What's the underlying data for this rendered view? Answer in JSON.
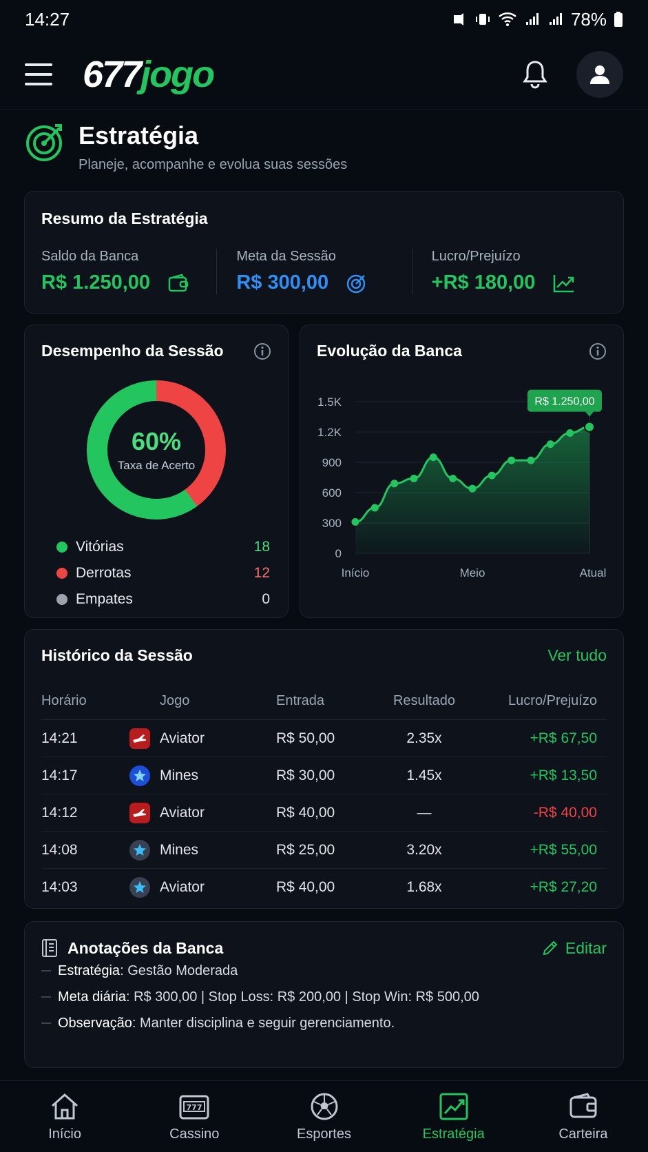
{
  "status": {
    "time": "14:27",
    "battery": "78%"
  },
  "header": {
    "logo_num": "677",
    "logo_word": "jogo"
  },
  "page": {
    "title": "Estratégia",
    "subtitle": "Planeje, acompanhe e evolua suas sessões"
  },
  "summary": {
    "title": "Resumo da Estratégia",
    "items": [
      {
        "label": "Saldo da Banca",
        "value": "R$ 1.250,00",
        "color": "#22c55e",
        "icon": "wallet-icon"
      },
      {
        "label": "Meta da Sessão",
        "value": "R$ 300,00",
        "color": "#2f8ff5",
        "icon": "target-icon"
      },
      {
        "label": "Lucro/Prejuízo",
        "value": "+R$ 180,00",
        "color": "#22c55e",
        "icon": "trend-up-icon"
      }
    ]
  },
  "performance": {
    "title": "Desempenho da Sessão",
    "rate": "60%",
    "rate_label": "Taxa de Acerto",
    "legend": [
      {
        "label": "Vitórias",
        "value": "18",
        "color": "#22c55e"
      },
      {
        "label": "Derrotas",
        "value": "12",
        "color": "#ef4444"
      },
      {
        "label": "Empates",
        "value": "0",
        "color": "#9ca3af"
      }
    ]
  },
  "evolution": {
    "title": "Evolução da Banca",
    "tooltip": "R$ 1.250,00"
  },
  "chart_data": {
    "type": "area",
    "title": "Evolução da Banca",
    "y_ticks": [
      "0",
      "300",
      "600",
      "900",
      "1.2K",
      "1.5K"
    ],
    "ylim": [
      0,
      1500
    ],
    "x_labels": [
      "Início",
      "Meio",
      "Atual"
    ],
    "values": [
      310,
      450,
      690,
      740,
      950,
      740,
      640,
      770,
      920,
      920,
      1080,
      1190,
      1250
    ],
    "grid": true,
    "color": "#22c55e"
  },
  "history": {
    "title": "Histórico da Sessão",
    "view_all": "Ver tudo",
    "columns": [
      "Horário",
      "Jogo",
      "Entrada",
      "Resultado",
      "Lucro/Prejuízo"
    ],
    "rows": [
      {
        "time": "14:21",
        "game": "Aviator",
        "icon": "aviator",
        "entry": "R$ 50,00",
        "result": "2.35x",
        "pl": "+R$ 67,50",
        "positive": true
      },
      {
        "time": "14:17",
        "game": "Mines",
        "icon": "mines",
        "entry": "R$ 30,00",
        "result": "1.45x",
        "pl": "+R$ 13,50",
        "positive": true
      },
      {
        "time": "14:12",
        "game": "Aviator",
        "icon": "aviator",
        "entry": "R$ 40,00",
        "result": "—",
        "pl": "-R$ 40,00",
        "positive": false
      },
      {
        "time": "14:08",
        "game": "Mines",
        "icon": "mines-dark",
        "entry": "R$ 25,00",
        "result": "3.20x",
        "pl": "+R$ 55,00",
        "positive": true
      },
      {
        "time": "14:03",
        "game": "Aviator",
        "icon": "mines-dark",
        "entry": "R$ 40,00",
        "result": "1.68x",
        "pl": "+R$ 27,20",
        "positive": true
      }
    ]
  },
  "notes": {
    "title": "Anotações da Banca",
    "edit": "Editar",
    "lines": [
      {
        "key": "Estratégia",
        "text": "Gestão Moderada"
      },
      {
        "key": "Meta diária",
        "text": "R$ 300,00 | Stop Loss: R$ 200,00 | Stop Win: R$ 500,00"
      },
      {
        "key": "Observação",
        "text": "Manter disciplina e seguir gerenciamento."
      }
    ]
  },
  "nav": [
    {
      "label": "Início",
      "icon": "home-icon",
      "active": false
    },
    {
      "label": "Cassino",
      "icon": "slot-machine-icon",
      "active": false
    },
    {
      "label": "Esportes",
      "icon": "soccer-ball-icon",
      "active": false
    },
    {
      "label": "Estratégia",
      "icon": "strategy-chart-icon",
      "active": true
    },
    {
      "label": "Carteira",
      "icon": "wallet-icon",
      "active": false
    }
  ]
}
